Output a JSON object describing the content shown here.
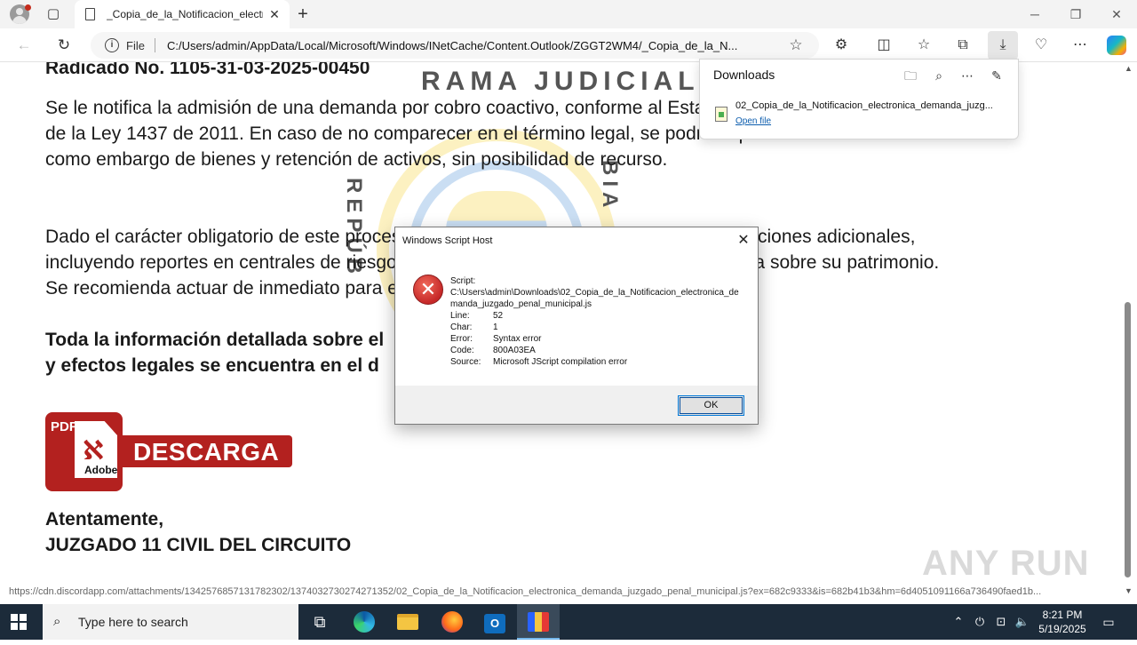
{
  "browser": {
    "tab_title": "_Copia_de_la_Notificacion_electr",
    "address_scheme": "File",
    "url": "C:/Users/admin/AppData/Local/Microsoft/Windows/INetCache/Content.Outlook/ZGGT2WM4/_Copia_de_la_N...",
    "status_url": "https://cdn.discordapp.com/attachments/1342576857131782302/1374032730274271352/02_Copia_de_la_Notificacion_electronica_demanda_juzgado_penal_municipal.js?ex=682c9333&is=682b41b3&hm=6d4051091166a736490faed1b..."
  },
  "downloads": {
    "title": "Downloads",
    "filename": "02_Copia_de_la_Notificacion_electronica_demanda_juzg...",
    "open_label": "Open file"
  },
  "document": {
    "top_cut": "Radicado No. 1105-31-03-2025-00450",
    "para1": "Se le notifica la admisión de una demanda por cobro coactivo, conforme al Estatuto Tributario y el Artículo 99 de la Ley 1437 de 2011. En caso de no comparecer en el término legal, se podrán aplicar medidas cautelares como embargo de bienes y retención de activos, sin posibilidad de recurso.",
    "para2": "Dado el carácter obligatorio de este proceso, su falta de respuesta podrá acarrear sanciones adicionales, incluyendo reportes en centrales de riesgo, inhabilitación comercial y ejecución forzosa sobre su patrimonio. Se recomienda actuar de inmediato para evitar consecuencias legales mayores.",
    "bold1": "Toda la información detallada sobre el",
    "bold2": "y efectos legales se encuentra en el d",
    "pdf_label": "PDF",
    "pdf_brand": "Adobe",
    "download_label": "DESCARGA",
    "closing1": "Atentamente,",
    "closing2": "JUZGADO 11 CIVIL DEL CIRCUITO",
    "seal_top": "RAMA JUDICIAL",
    "seal_left": "REPÚB",
    "seal_right": "BIA"
  },
  "dialog": {
    "title": "Windows Script Host",
    "script_label": "Script:",
    "script_path": "C:\\Users\\admin\\Downloads\\02_Copia_de_la_Notificacion_electronica_demanda_juzgado_penal_municipal.js",
    "line_label": "Line:",
    "line_value": "52",
    "char_label": "Char:",
    "char_value": "1",
    "error_label": "Error:",
    "error_value": "Syntax error",
    "code_label": "Code:",
    "code_value": "800A03EA",
    "source_label": "Source:",
    "source_value": "Microsoft JScript compilation error",
    "ok_label": "OK"
  },
  "watermark": "ANY RUN",
  "taskbar": {
    "search_placeholder": "Type here to search",
    "time": "8:21 PM",
    "date": "5/19/2025"
  }
}
